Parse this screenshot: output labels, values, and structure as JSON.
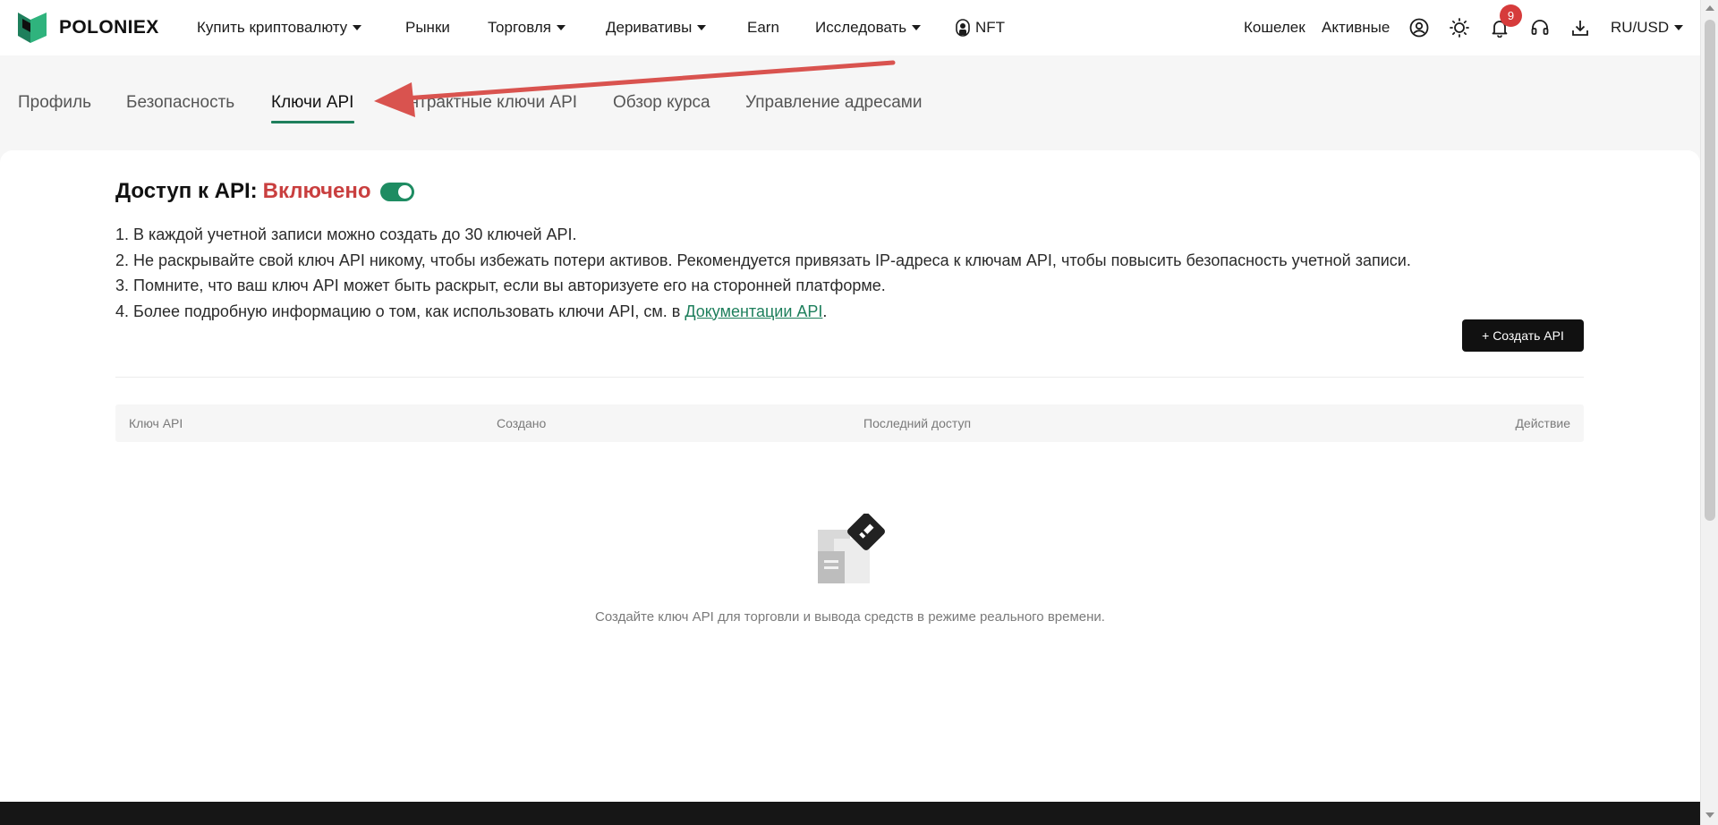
{
  "brand": {
    "name": "POLONIEX"
  },
  "nav": {
    "buy_crypto": "Купить криптовалюту",
    "markets": "Рынки",
    "trading": "Торговля",
    "derivatives": "Деривативы",
    "earn": "Earn",
    "explore": "Исследовать",
    "nft": "NFT"
  },
  "right_nav": {
    "wallet": "Кошелек",
    "assets": "Активные",
    "notifications_count": "9",
    "locale": "RU/USD"
  },
  "tabs": {
    "profile": "Профиль",
    "security": "Безопасность",
    "api_keys": "Ключи API",
    "contract_keys": "Контрактные ключи API",
    "course_review": "Обзор курса",
    "address_management": "Управление адресами"
  },
  "api_access": {
    "title": "Доступ к API:",
    "status": "Включено",
    "toggle_on": true
  },
  "rules": {
    "line1": "1. В каждой учетной записи можно создать до 30 ключей API.",
    "line2": "2. Не раскрывайте свой ключ API никому, чтобы избежать потери активов. Рекомендуется привязать IP-адреса к ключам API, чтобы повысить безопасность учетной записи.",
    "line3": "3. Помните, что ваш ключ API может быть раскрыт, если вы авторизуете его на сторонней платформе.",
    "line4_prefix": "4. Более подробную информацию о том, как использовать ключи API, см. в ",
    "line4_link": "Документации API",
    "line4_suffix": "."
  },
  "create_button": "+ Создать API",
  "table": {
    "columns": [
      "Ключ API",
      "Создано",
      "Последний доступ",
      "Действие"
    ],
    "rows": []
  },
  "empty_state": {
    "text": "Создайте ключ API для торговли и вывода средств в режиме реального времени."
  },
  "colors": {
    "accent": "#1e7f5c",
    "status_red": "#c93f3f",
    "annotation_arrow": "#d9534f"
  }
}
